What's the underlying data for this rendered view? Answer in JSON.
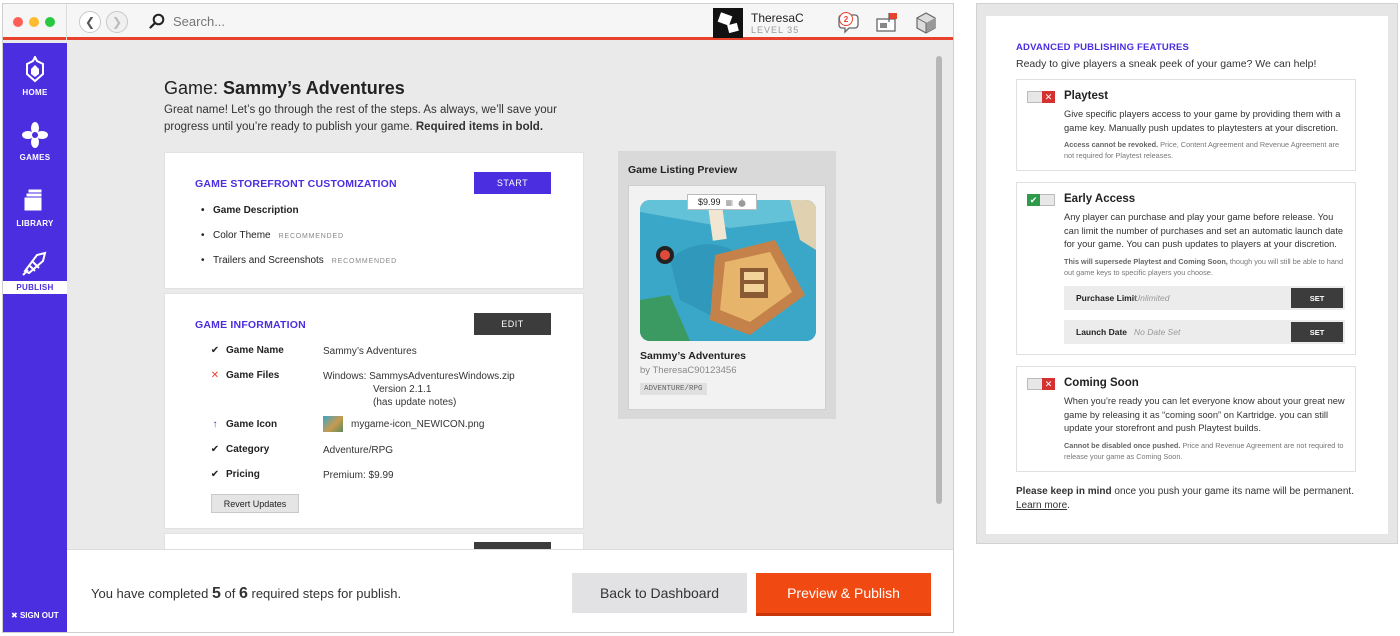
{
  "header": {
    "search_placeholder": "Search...",
    "username": "TheresaC",
    "level": "LEVEL 35",
    "notifications_count": "2"
  },
  "sidebar": {
    "items": [
      {
        "label": "HOME"
      },
      {
        "label": "GAMES"
      },
      {
        "label": "LIBRARY"
      },
      {
        "label": "PUBLISH"
      }
    ],
    "signout": "SIGN OUT"
  },
  "main": {
    "title_prefix": "Game:",
    "title_name": "Sammy’s Adventures",
    "intro": "Great name! Let’s go through the rest of the steps. As always, we’ll save your progress until you’re ready to publish your game.",
    "intro_bold": "Required items in bold.",
    "storefront": {
      "heading": "GAME STOREFRONT CUSTOMIZATION",
      "button": "START",
      "items": [
        {
          "label": "Game Description",
          "tag": ""
        },
        {
          "label": "Color Theme",
          "tag": "RECOMMENDED"
        },
        {
          "label": "Trailers and Screenshots",
          "tag": "RECOMMENDED"
        }
      ]
    },
    "info": {
      "heading": "GAME INFORMATION",
      "button": "EDIT",
      "rows": [
        {
          "mark": "✔",
          "status": "complete",
          "key": "Game Name",
          "value": "Sammy’s Adventures"
        },
        {
          "mark": "✕",
          "status": "error",
          "key": "Game Files",
          "value": "Windows:  SammysAdventuresWindows.zip",
          "value2": "Version 2.1.1",
          "value3": "(has update notes)"
        },
        {
          "mark": "↑",
          "status": "updated",
          "key": "Game Icon",
          "value": "mygame-icon_NEWICON.png"
        },
        {
          "mark": "✔",
          "status": "complete",
          "key": "Category",
          "value": "Adventure/RPG"
        },
        {
          "mark": "✔",
          "status": "complete",
          "key": "Pricing",
          "value": "Premium: $9.99"
        }
      ],
      "revert": "Revert Updates"
    }
  },
  "preview": {
    "heading": "Game Listing Preview",
    "price": "$9.99",
    "name": "Sammy’s Adventures",
    "by": "by TheresaC90123456",
    "tag": "ADVENTURE/RPG"
  },
  "footer": {
    "text_a": "You have completed",
    "done": "5",
    "text_b": "of",
    "total": "6",
    "text_c": "required steps for publish.",
    "back": "Back to Dashboard",
    "publish": "Preview & Publish"
  },
  "advanced": {
    "heading": "ADVANCED PUBLISHING FEATURES",
    "sub": "Ready to give players a sneak peek of your game? We can help!",
    "playtest": {
      "title": "Playtest",
      "enabled": false,
      "desc": "Give specific players access to your game by providing them with a game key. Manually push updates to playtesters at your discretion.",
      "note_bold": "Access cannot be revoked.",
      "note": "Price, Content Agreement and Revenue Agreement are not required for Playtest releases."
    },
    "early": {
      "title": "Early Access",
      "enabled": true,
      "desc": "Any player can purchase and play your game before release. You can limit the number of purchases and set an automatic launch date for your game. You can push updates to players at your discretion.",
      "note_bold": "This will supersede Playtest and Coming Soon,",
      "note": "though you will still be able to hand out game keys to specific players you choose.",
      "limit_label": "Purchase Limit",
      "limit_value": "Unlimited",
      "date_label": "Launch Date",
      "date_value": "No Date Set",
      "set": "SET"
    },
    "soon": {
      "title": "Coming Soon",
      "enabled": false,
      "desc": "When you’re ready you can let everyone know about your great new game by releasing it as “coming soon” on Kartridge. you can still update your storefront and push Playtest builds.",
      "note_bold": "Cannot be disabled once pushed.",
      "note": "Price and Revenue Agreement are not required to release your game as Coming Soon."
    },
    "keep_bold": "Please keep in mind",
    "keep": "once you push your game its name will be permanent.",
    "learn": "Learn more",
    "learn_end": "."
  },
  "colors": {
    "brand": "#4b2ee0",
    "accent": "#f04a12",
    "red": "#e8422d",
    "green": "#2f9a4a"
  }
}
